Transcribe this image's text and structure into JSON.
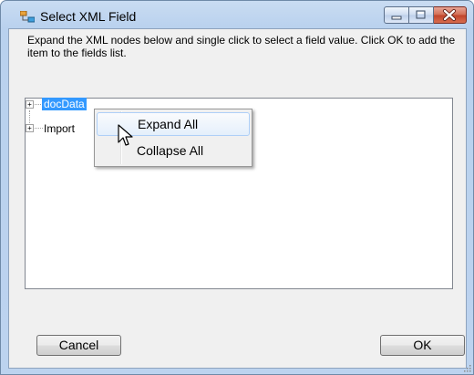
{
  "window": {
    "title": "Select XML Field"
  },
  "instructions": "Expand the XML nodes below and single click to select a field value.  Click OK to add the item to the fields list.",
  "tree": {
    "nodes": [
      {
        "label": "docData",
        "selected": true,
        "expander": "+"
      },
      {
        "label": "Import",
        "selected": false,
        "expander": "+"
      }
    ]
  },
  "context_menu": {
    "items": [
      {
        "label": "Expand All",
        "highlighted": true
      },
      {
        "label": "Collapse All",
        "highlighted": false
      }
    ]
  },
  "buttons": {
    "cancel": "Cancel",
    "ok": "OK"
  },
  "icons": {
    "app": "tree-structure-icon",
    "minimize": "minimize-icon",
    "maximize": "maximize-icon",
    "close": "close-icon",
    "cursor": "mouse-pointer-icon",
    "resize": "resize-grip-icon"
  },
  "colors": {
    "selection": "#3399ff",
    "close_button": "#c0432a",
    "title_bar": "#c9dcf2"
  }
}
